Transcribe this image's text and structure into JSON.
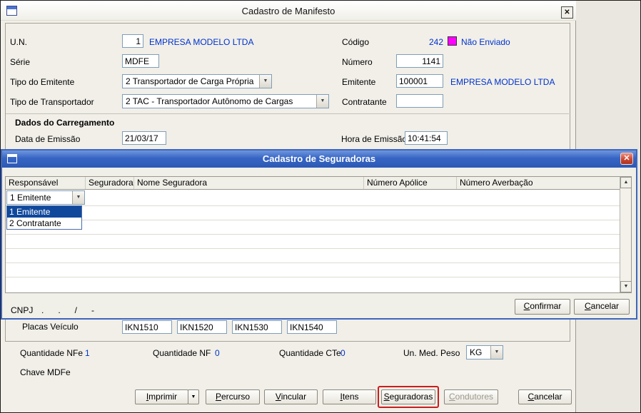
{
  "icons": {
    "close": "✕",
    "dropdown": "▼",
    "scroll_up": "▲",
    "scroll_down": "▼"
  },
  "colors": {
    "value_text": "#0033cc",
    "status_swatch": "#ff00ff",
    "selection_blue": "#10489c",
    "highlight_border": "#c81e1e",
    "modal_titlebar_blue": "#3765c4"
  },
  "main": {
    "title": "Cadastro de Manifesto",
    "un_label": "U.N.",
    "un_value": "1",
    "un_company": "EMPRESA MODELO LTDA",
    "codigo_label": "Código",
    "codigo_value": "242",
    "codigo_status": "Não Enviado",
    "serie_label": "Série",
    "serie_value": "MDFE",
    "numero_label": "Número",
    "numero_value": "1141",
    "tipo_emitente_label": "Tipo do Emitente",
    "tipo_emitente_value": "2 Transportador de Carga Própria",
    "emitente_label": "Emitente",
    "emitente_value": "100001",
    "emitente_company": "EMPRESA MODELO LTDA",
    "tipo_transportador_label": "Tipo de Transportador",
    "tipo_transportador_value": "2 TAC - Transportador Autônomo de Cargas",
    "contratante_label": "Contratante",
    "contratante_value": "",
    "section_carregamento": "Dados do Carregamento",
    "data_emissao_label": "Data de Emissão",
    "data_emissao_value": "21/03/17",
    "hora_emissao_label": "Hora de Emissão",
    "hora_emissao_value": "10:41:54",
    "placas_label": "Placas Veículo",
    "placas": [
      "IKN1510",
      "IKN1520",
      "IKN1530",
      "IKN1540"
    ],
    "qtd_nfe_label": "Quantidade NFe",
    "qtd_nfe_value": "1",
    "qtd_nf_label": "Quantidade NF",
    "qtd_nf_value": "0",
    "qtd_cte_label": "Quantidade CTe",
    "qtd_cte_value": "0",
    "un_med_peso_label": "Un. Med. Peso",
    "un_med_peso_value": "KG",
    "chave_label": "Chave MDFe",
    "btn_imprimir": "Imprimir",
    "btn_percurso": "Percurso",
    "btn_vincular": "Vincular",
    "btn_itens": "Itens",
    "btn_seguradoras": "Seguradoras",
    "btn_condutores": "Condutores",
    "btn_cancelar": "Cancelar"
  },
  "modal": {
    "title": "Cadastro de Seguradoras",
    "columns": [
      "Responsável",
      "Seguradora",
      "Nome Seguradora",
      "Número Apólice",
      "Número Averbação"
    ],
    "combo_value": "1 Emitente",
    "combo_options": [
      "1 Emitente",
      "2 Contratante"
    ],
    "cnpj_label": "CNPJ",
    "cnpj_mask": ".      .      /      -",
    "btn_confirmar": "Confirmar",
    "btn_cancelar": "Cancelar"
  }
}
